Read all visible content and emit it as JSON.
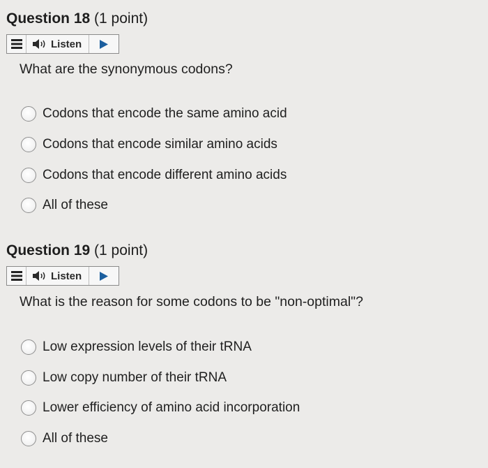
{
  "questions": [
    {
      "number": "Question 18",
      "points": "(1 point)",
      "listen_label": "Listen",
      "text": "What are the synonymous codons?",
      "options": [
        "Codons that encode the same amino acid",
        "Codons that encode similar amino acids",
        "Codons that encode different amino acids",
        "All of these"
      ]
    },
    {
      "number": "Question 19",
      "points": "(1 point)",
      "listen_label": "Listen",
      "text": "What is the reason for some codons to be \"non-optimal\"?",
      "options": [
        "Low expression levels of their tRNA",
        "Low copy number of their tRNA",
        "Lower efficiency of amino acid incorporation",
        "All of these"
      ]
    }
  ]
}
